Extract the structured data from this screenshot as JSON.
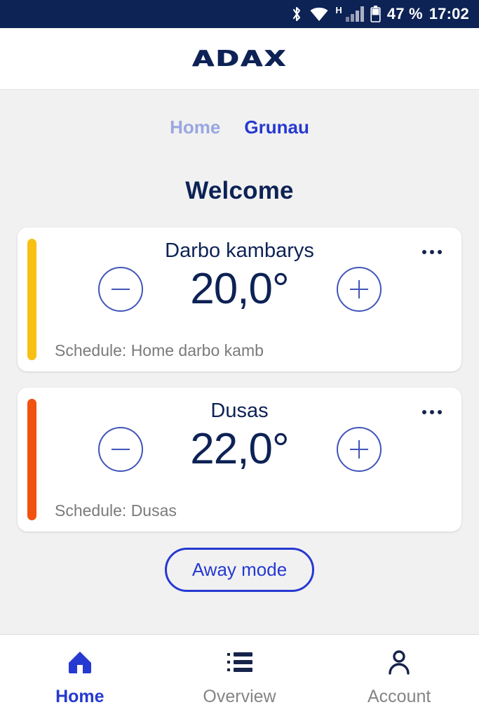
{
  "status_bar": {
    "bluetooth_icon": "bluetooth-icon",
    "wifi_icon": "wifi-icon",
    "network_type": "H",
    "signal_icon": "signal-bars-icon",
    "battery_icon": "battery-icon",
    "battery_level": "47 %",
    "clock": "17:02",
    "background_color": "#0d2255"
  },
  "app_header": {
    "logo_text": "ADAX",
    "logo_color": "#0d2255"
  },
  "breadcrumb": {
    "items": [
      {
        "label": "Home",
        "active": false
      },
      {
        "label": "Grunau",
        "active": true
      }
    ],
    "inactive_color": "#9aa7e0",
    "active_color": "#2639d1"
  },
  "main": {
    "page_title": "Welcome",
    "rooms": [
      {
        "name": "Darbo kambarys",
        "temperature": "20,0°",
        "schedule": "Schedule: Home darbo kamb",
        "bar_color": "#f7c013",
        "decrease_label": "−",
        "increase_label": "+",
        "menu_label": "•••"
      },
      {
        "name": "Dusas",
        "temperature": "22,0°",
        "schedule": "Schedule: Dusas",
        "bar_color": "#f0520f",
        "decrease_label": "−",
        "increase_label": "+",
        "menu_label": "•••"
      }
    ],
    "away_button": "Away mode"
  },
  "bottom_nav": {
    "items": [
      {
        "label": "Home",
        "icon": "home-icon",
        "active": true
      },
      {
        "label": "Overview",
        "icon": "list-icon",
        "active": false
      },
      {
        "label": "Account",
        "icon": "person-icon",
        "active": false
      }
    ],
    "active_color": "#2639d1",
    "inactive_color": "#848484",
    "icon_color": "#16244a"
  }
}
